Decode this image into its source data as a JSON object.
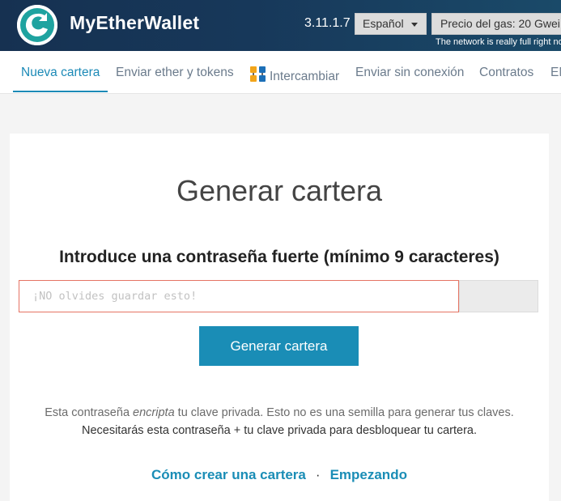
{
  "header": {
    "brand": "MyEtherWallet",
    "version": "3.11.1.7",
    "language": "Español",
    "gas_price": "Precio del gas: 20 Gwei",
    "network_note": "The network is really full right now."
  },
  "nav": {
    "items": [
      {
        "label": "Nueva cartera"
      },
      {
        "label": "Enviar ether y tokens"
      },
      {
        "label": "Intercambiar"
      },
      {
        "label": "Enviar sin conexión"
      },
      {
        "label": "Contratos"
      },
      {
        "label": "ENS"
      }
    ],
    "active_index": 0
  },
  "main": {
    "title": "Generar cartera",
    "subtitle": "Introduce una contraseña fuerte (mínimo 9 caracteres)",
    "password": {
      "placeholder": "¡NO olvides guardar esto!",
      "value": ""
    },
    "generate_button": "Generar cartera",
    "note_line1_pre": "Esta contraseña ",
    "note_line1_em": "encripta",
    "note_line1_post": " tu clave privada. Esto no es una semilla para generar tus claves.",
    "note_line2": "Necesitarás esta contraseña + tu clave privada para desbloquear tu cartera.",
    "link_create": "Cómo crear una cartera",
    "link_separator": "·",
    "link_start": "Empezando"
  },
  "colors": {
    "header_bg": "#163151",
    "accent": "#1a8db6",
    "input_border_error": "#e57363"
  },
  "icons": {
    "logo": "myetherwallet-logo-icon",
    "swap": "swap-icon",
    "caret": "caret-down-icon"
  }
}
